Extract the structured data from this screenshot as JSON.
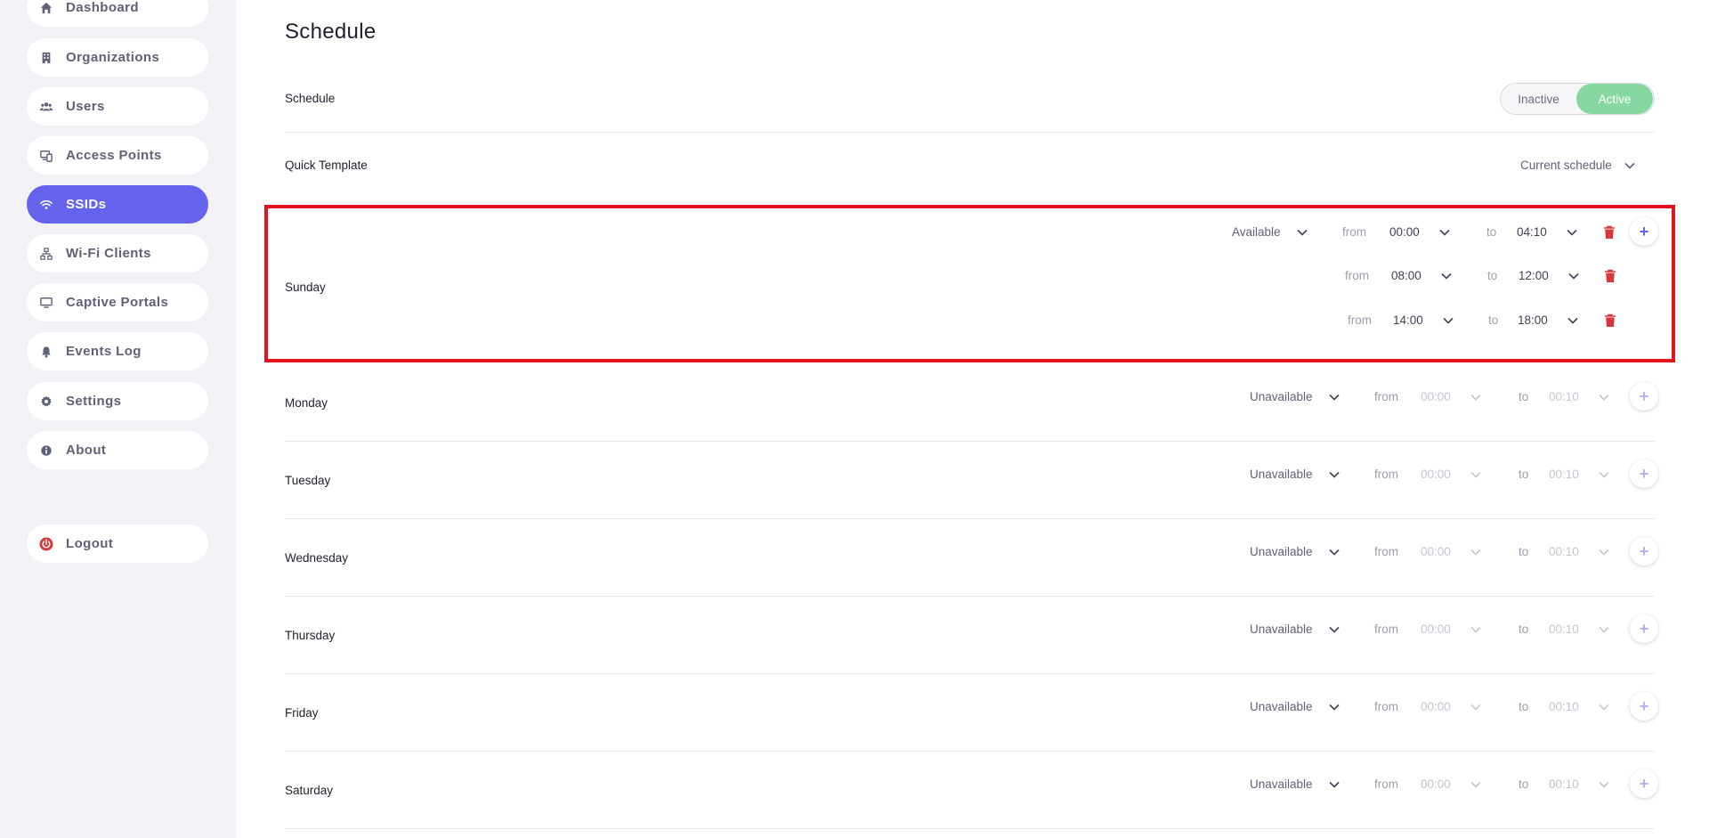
{
  "sidebar": {
    "items": [
      {
        "label": "Dashboard",
        "icon": "home-icon"
      },
      {
        "label": "Organizations",
        "icon": "building-icon"
      },
      {
        "label": "Users",
        "icon": "users-icon"
      },
      {
        "label": "Access Points",
        "icon": "devices-icon"
      },
      {
        "label": "SSIDs",
        "icon": "wifi-icon",
        "active": true
      },
      {
        "label": "Wi-Fi Clients",
        "icon": "network-icon"
      },
      {
        "label": "Captive Portals",
        "icon": "monitor-icon"
      },
      {
        "label": "Events Log",
        "icon": "bell-icon"
      },
      {
        "label": "Settings",
        "icon": "gear-icon"
      },
      {
        "label": "About",
        "icon": "info-icon"
      }
    ],
    "logout": {
      "label": "Logout",
      "icon": "power-icon"
    }
  },
  "page": {
    "title": "Schedule",
    "schedule_label": "Schedule",
    "toggle": {
      "inactive": "Inactive",
      "active": "Active",
      "selected": "Active"
    },
    "quick_template_label": "Quick Template",
    "quick_template_value": "Current schedule"
  },
  "labels": {
    "from": "from",
    "to": "to"
  },
  "days": [
    {
      "name": "Sunday",
      "availability": "Available",
      "ranges": [
        {
          "from": "00:00",
          "to": "04:10"
        },
        {
          "from": "08:00",
          "to": "12:00"
        },
        {
          "from": "14:00",
          "to": "18:00"
        }
      ]
    },
    {
      "name": "Monday",
      "availability": "Unavailable",
      "ranges": [
        {
          "from": "00:00",
          "to": "00:10"
        }
      ]
    },
    {
      "name": "Tuesday",
      "availability": "Unavailable",
      "ranges": [
        {
          "from": "00:00",
          "to": "00:10"
        }
      ]
    },
    {
      "name": "Wednesday",
      "availability": "Unavailable",
      "ranges": [
        {
          "from": "00:00",
          "to": "00:10"
        }
      ]
    },
    {
      "name": "Thursday",
      "availability": "Unavailable",
      "ranges": [
        {
          "from": "00:00",
          "to": "00:10"
        }
      ]
    },
    {
      "name": "Friday",
      "availability": "Unavailable",
      "ranges": [
        {
          "from": "00:00",
          "to": "00:10"
        }
      ]
    },
    {
      "name": "Saturday",
      "availability": "Unavailable",
      "ranges": [
        {
          "from": "00:00",
          "to": "00:10"
        }
      ]
    }
  ],
  "colors": {
    "accent": "#6563ec",
    "active_toggle": "#86d8a0",
    "delete": "#d9383a",
    "highlight": "#e3141c",
    "sidebar_bg": "#f1f1f6"
  }
}
